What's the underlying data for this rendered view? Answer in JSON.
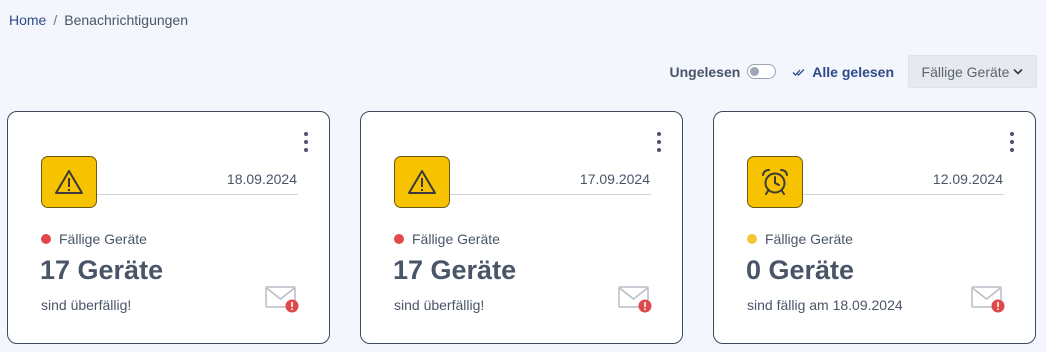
{
  "breadcrumb": {
    "home": "Home",
    "separator": "/",
    "current": "Benachrichtigungen"
  },
  "toolbar": {
    "unread_label": "Ungelesen",
    "unread_on": false,
    "mark_all_label": "Alle gelesen",
    "filter_value": "Fällige Geräte"
  },
  "colors": {
    "accent": "#2f4a8a",
    "icon_bg": "#f7c300",
    "red": "#e0494b",
    "yellow": "#f5c634"
  },
  "cards": [
    {
      "date": "18.09.2024",
      "icon": "warning-icon",
      "status_color": "#e0494b",
      "category": "Fällige Geräte",
      "count": "17 Geräte",
      "subtitle": "sind überfällig!"
    },
    {
      "date": "17.09.2024",
      "icon": "warning-icon",
      "status_color": "#e0494b",
      "category": "Fällige Geräte",
      "count": "17 Geräte",
      "subtitle": "sind überfällig!"
    },
    {
      "date": "12.09.2024",
      "icon": "alarm-clock-icon",
      "status_color": "#f5c634",
      "category": "Fällige Geräte",
      "count": "0 Geräte",
      "subtitle": "sind fällig am 18.09.2024"
    }
  ]
}
